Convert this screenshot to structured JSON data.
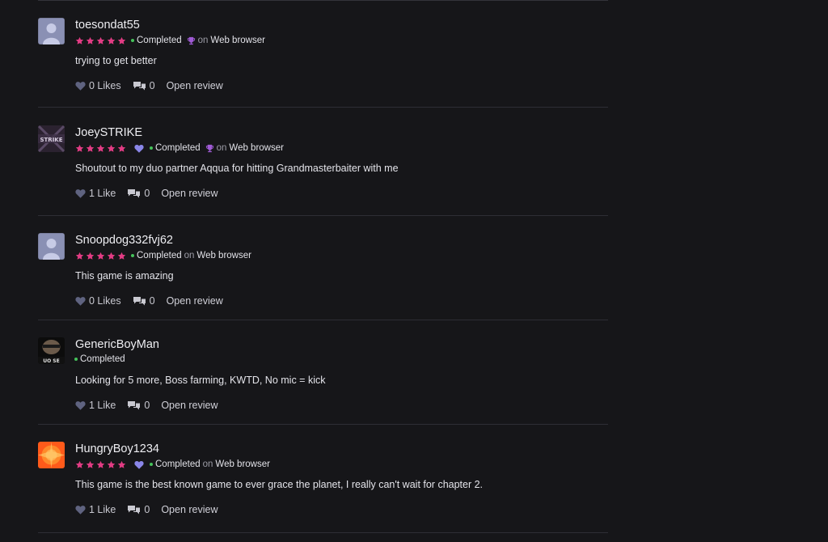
{
  "colors": {
    "background": "#161619",
    "star": "#e23c84",
    "heart_badge": "#8a86e8",
    "completed_dot": "#45c25a",
    "trophy": "#a05bd6",
    "divider": "#2e2e35"
  },
  "reviews": [
    {
      "username": "toesondat55",
      "avatar": "default-avatar",
      "stars": 5,
      "hearted": false,
      "status": "Completed",
      "trophy": true,
      "on": "on",
      "platform": "Web browser",
      "text": "trying to get better",
      "likes": "0 Likes",
      "comments": "0",
      "open": "Open review"
    },
    {
      "username": "JoeySTRIKE",
      "avatar": "strike-avatar",
      "avatar_text": "STRIKE",
      "stars": 5,
      "hearted": true,
      "status": "Completed",
      "trophy": true,
      "on": "on",
      "platform": "Web browser",
      "text": "Shoutout to my duo partner Aqqua for hitting Grandmasterbaiter with me",
      "likes": "1 Like",
      "comments": "0",
      "open": "Open review"
    },
    {
      "username": "Snoopdog332fvj62",
      "avatar": "default-avatar",
      "stars": 5,
      "hearted": false,
      "status": "Completed",
      "trophy": false,
      "on": "on",
      "platform": "Web browser",
      "text": "This game is amazing",
      "likes": "0 Likes",
      "comments": "0",
      "open": "Open review"
    },
    {
      "username": "GenericBoyMan",
      "avatar": "face-avatar",
      "avatar_text": "UO SE",
      "stars": 0,
      "hearted": false,
      "status": "Completed",
      "trophy": false,
      "on": "",
      "platform": "",
      "text": "Looking for 5 more, Boss farming, KWTD, No mic = kick",
      "likes": "1 Like",
      "comments": "0",
      "open": "Open review"
    },
    {
      "username": "HungryBoy1234",
      "avatar": "burst-avatar",
      "stars": 5,
      "hearted": true,
      "status": "Completed",
      "trophy": false,
      "on": "on",
      "platform": "Web browser",
      "text": "This game is the best known game to ever grace the planet, I really can't wait for chapter 2.",
      "likes": "1 Like",
      "comments": "0",
      "open": "Open review"
    }
  ]
}
